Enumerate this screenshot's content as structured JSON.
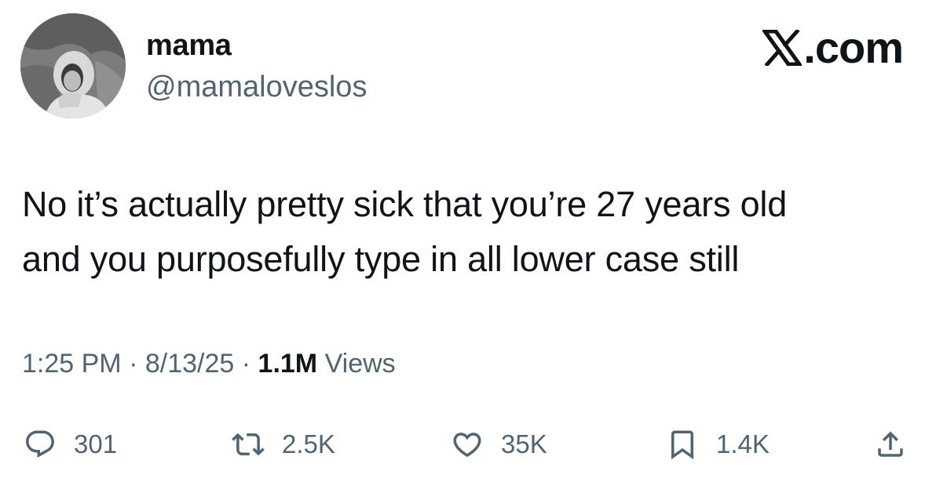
{
  "author": {
    "display_name": "mama",
    "handle": "@mamaloveslos",
    "avatar_alt": "profile photo"
  },
  "brand": {
    "label": ".com",
    "icon": "x-logo-icon"
  },
  "tweet": {
    "line1": "No it’s actually pretty sick that you’re 27 years old",
    "line2": "and you purposefully type in all lower case still"
  },
  "meta": {
    "time": "1:25 PM",
    "separator": "·",
    "date": "8/13/25",
    "views_count": "1.1M",
    "views_label": "Views"
  },
  "actions": {
    "reply": {
      "icon": "reply-bubble-icon",
      "count": "301"
    },
    "repost": {
      "icon": "repost-arrows-icon",
      "count": "2.5K"
    },
    "like": {
      "icon": "heart-icon",
      "count": "35K"
    },
    "bookmark": {
      "icon": "bookmark-icon",
      "count": "1.4K"
    },
    "share": {
      "icon": "share-upload-icon"
    }
  },
  "colors": {
    "text_primary": "#0f1419",
    "text_secondary": "#536471",
    "background": "#ffffff"
  }
}
